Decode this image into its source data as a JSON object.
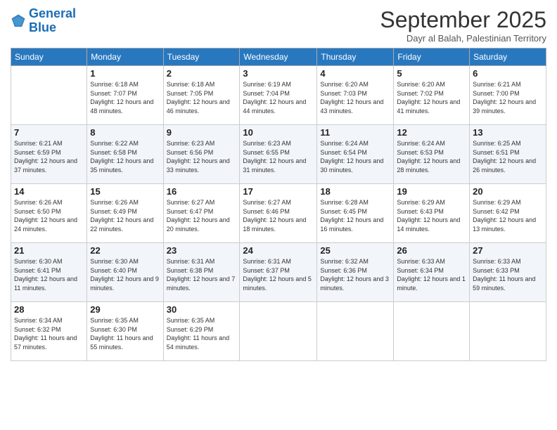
{
  "logo": {
    "line1": "General",
    "line2": "Blue"
  },
  "title": "September 2025",
  "subtitle": "Dayr al Balah, Palestinian Territory",
  "header_days": [
    "Sunday",
    "Monday",
    "Tuesday",
    "Wednesday",
    "Thursday",
    "Friday",
    "Saturday"
  ],
  "weeks": [
    [
      {
        "day": "",
        "sunrise": "",
        "sunset": "",
        "daylight": ""
      },
      {
        "day": "1",
        "sunrise": "Sunrise: 6:18 AM",
        "sunset": "Sunset: 7:07 PM",
        "daylight": "Daylight: 12 hours and 48 minutes."
      },
      {
        "day": "2",
        "sunrise": "Sunrise: 6:18 AM",
        "sunset": "Sunset: 7:05 PM",
        "daylight": "Daylight: 12 hours and 46 minutes."
      },
      {
        "day": "3",
        "sunrise": "Sunrise: 6:19 AM",
        "sunset": "Sunset: 7:04 PM",
        "daylight": "Daylight: 12 hours and 44 minutes."
      },
      {
        "day": "4",
        "sunrise": "Sunrise: 6:20 AM",
        "sunset": "Sunset: 7:03 PM",
        "daylight": "Daylight: 12 hours and 43 minutes."
      },
      {
        "day": "5",
        "sunrise": "Sunrise: 6:20 AM",
        "sunset": "Sunset: 7:02 PM",
        "daylight": "Daylight: 12 hours and 41 minutes."
      },
      {
        "day": "6",
        "sunrise": "Sunrise: 6:21 AM",
        "sunset": "Sunset: 7:00 PM",
        "daylight": "Daylight: 12 hours and 39 minutes."
      }
    ],
    [
      {
        "day": "7",
        "sunrise": "Sunrise: 6:21 AM",
        "sunset": "Sunset: 6:59 PM",
        "daylight": "Daylight: 12 hours and 37 minutes."
      },
      {
        "day": "8",
        "sunrise": "Sunrise: 6:22 AM",
        "sunset": "Sunset: 6:58 PM",
        "daylight": "Daylight: 12 hours and 35 minutes."
      },
      {
        "day": "9",
        "sunrise": "Sunrise: 6:23 AM",
        "sunset": "Sunset: 6:56 PM",
        "daylight": "Daylight: 12 hours and 33 minutes."
      },
      {
        "day": "10",
        "sunrise": "Sunrise: 6:23 AM",
        "sunset": "Sunset: 6:55 PM",
        "daylight": "Daylight: 12 hours and 31 minutes."
      },
      {
        "day": "11",
        "sunrise": "Sunrise: 6:24 AM",
        "sunset": "Sunset: 6:54 PM",
        "daylight": "Daylight: 12 hours and 30 minutes."
      },
      {
        "day": "12",
        "sunrise": "Sunrise: 6:24 AM",
        "sunset": "Sunset: 6:53 PM",
        "daylight": "Daylight: 12 hours and 28 minutes."
      },
      {
        "day": "13",
        "sunrise": "Sunrise: 6:25 AM",
        "sunset": "Sunset: 6:51 PM",
        "daylight": "Daylight: 12 hours and 26 minutes."
      }
    ],
    [
      {
        "day": "14",
        "sunrise": "Sunrise: 6:26 AM",
        "sunset": "Sunset: 6:50 PM",
        "daylight": "Daylight: 12 hours and 24 minutes."
      },
      {
        "day": "15",
        "sunrise": "Sunrise: 6:26 AM",
        "sunset": "Sunset: 6:49 PM",
        "daylight": "Daylight: 12 hours and 22 minutes."
      },
      {
        "day": "16",
        "sunrise": "Sunrise: 6:27 AM",
        "sunset": "Sunset: 6:47 PM",
        "daylight": "Daylight: 12 hours and 20 minutes."
      },
      {
        "day": "17",
        "sunrise": "Sunrise: 6:27 AM",
        "sunset": "Sunset: 6:46 PM",
        "daylight": "Daylight: 12 hours and 18 minutes."
      },
      {
        "day": "18",
        "sunrise": "Sunrise: 6:28 AM",
        "sunset": "Sunset: 6:45 PM",
        "daylight": "Daylight: 12 hours and 16 minutes."
      },
      {
        "day": "19",
        "sunrise": "Sunrise: 6:29 AM",
        "sunset": "Sunset: 6:43 PM",
        "daylight": "Daylight: 12 hours and 14 minutes."
      },
      {
        "day": "20",
        "sunrise": "Sunrise: 6:29 AM",
        "sunset": "Sunset: 6:42 PM",
        "daylight": "Daylight: 12 hours and 13 minutes."
      }
    ],
    [
      {
        "day": "21",
        "sunrise": "Sunrise: 6:30 AM",
        "sunset": "Sunset: 6:41 PM",
        "daylight": "Daylight: 12 hours and 11 minutes."
      },
      {
        "day": "22",
        "sunrise": "Sunrise: 6:30 AM",
        "sunset": "Sunset: 6:40 PM",
        "daylight": "Daylight: 12 hours and 9 minutes."
      },
      {
        "day": "23",
        "sunrise": "Sunrise: 6:31 AM",
        "sunset": "Sunset: 6:38 PM",
        "daylight": "Daylight: 12 hours and 7 minutes."
      },
      {
        "day": "24",
        "sunrise": "Sunrise: 6:31 AM",
        "sunset": "Sunset: 6:37 PM",
        "daylight": "Daylight: 12 hours and 5 minutes."
      },
      {
        "day": "25",
        "sunrise": "Sunrise: 6:32 AM",
        "sunset": "Sunset: 6:36 PM",
        "daylight": "Daylight: 12 hours and 3 minutes."
      },
      {
        "day": "26",
        "sunrise": "Sunrise: 6:33 AM",
        "sunset": "Sunset: 6:34 PM",
        "daylight": "Daylight: 12 hours and 1 minute."
      },
      {
        "day": "27",
        "sunrise": "Sunrise: 6:33 AM",
        "sunset": "Sunset: 6:33 PM",
        "daylight": "Daylight: 11 hours and 59 minutes."
      }
    ],
    [
      {
        "day": "28",
        "sunrise": "Sunrise: 6:34 AM",
        "sunset": "Sunset: 6:32 PM",
        "daylight": "Daylight: 11 hours and 57 minutes."
      },
      {
        "day": "29",
        "sunrise": "Sunrise: 6:35 AM",
        "sunset": "Sunset: 6:30 PM",
        "daylight": "Daylight: 11 hours and 55 minutes."
      },
      {
        "day": "30",
        "sunrise": "Sunrise: 6:35 AM",
        "sunset": "Sunset: 6:29 PM",
        "daylight": "Daylight: 11 hours and 54 minutes."
      },
      {
        "day": "",
        "sunrise": "",
        "sunset": "",
        "daylight": ""
      },
      {
        "day": "",
        "sunrise": "",
        "sunset": "",
        "daylight": ""
      },
      {
        "day": "",
        "sunrise": "",
        "sunset": "",
        "daylight": ""
      },
      {
        "day": "",
        "sunrise": "",
        "sunset": "",
        "daylight": ""
      }
    ]
  ]
}
